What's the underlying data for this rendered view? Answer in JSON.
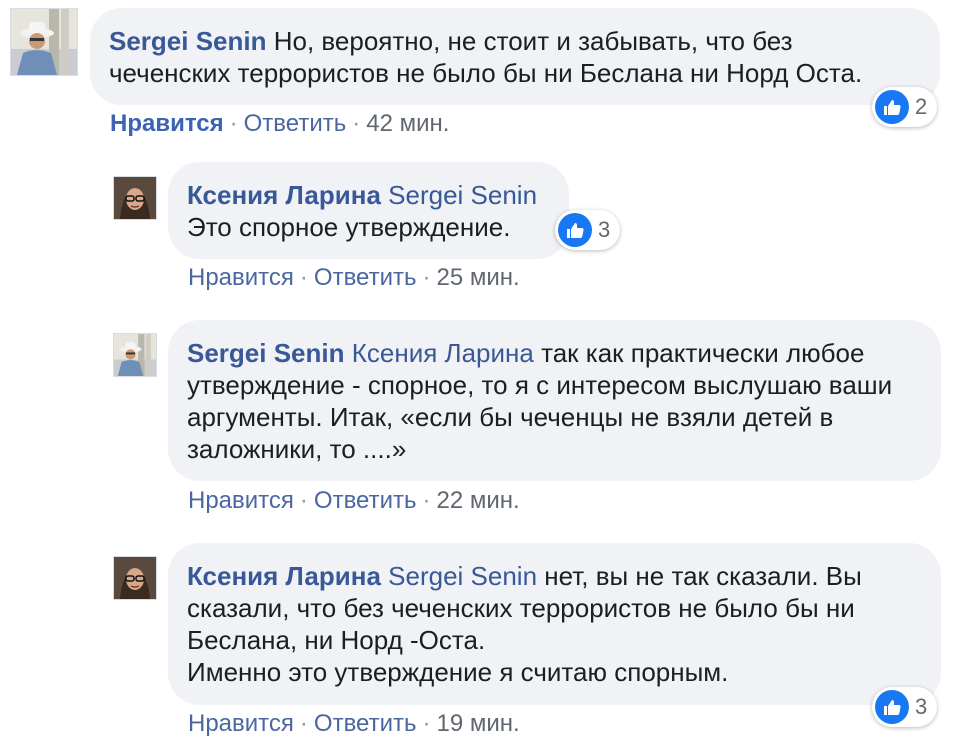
{
  "comments": [
    {
      "author": "Sergei Senin",
      "mention": "",
      "text": " Но, вероятно, не стоит и забывать, что без\nчеченских террористов не было бы ни Беслана ни Норд Оста.",
      "like_label": "Нравится",
      "reply_label": "Ответить",
      "time": "42 мин.",
      "reactions": "2",
      "avatar_icon": "profile-photo-man-in-hat"
    },
    {
      "author": "Ксения Ларина",
      "mention": "Sergei Senin",
      "text": "\nЭто спорное утверждение.",
      "like_label": "Нравится",
      "reply_label": "Ответить",
      "time": "25 мин.",
      "reactions": "3",
      "avatar_icon": "profile-photo-woman-glasses"
    },
    {
      "author": "Sergei Senin",
      "mention": "Ксения Ларина",
      "text": " так как практически любое\nутверждение - спорное, то я с интересом выслушаю ваши\nаргументы. Итак, «если бы чеченцы не взяли детей в\nзаложники, то ....»",
      "like_label": "Нравится",
      "reply_label": "Ответить",
      "time": "22 мин.",
      "reactions": "",
      "avatar_icon": "profile-photo-man-in-hat"
    },
    {
      "author": "Ксения Ларина",
      "mention": "Sergei Senin",
      "text": " нет, вы не так сказали. Вы\nсказали, что без чеченских террористов не было бы ни\nБеслана, ни Норд -Оста.\nИменно это утверждение я считаю спорным.",
      "like_label": "Нравится",
      "reply_label": "Ответить",
      "time": "19 мин.",
      "reactions": "3",
      "avatar_icon": "profile-photo-woman-glasses"
    }
  ],
  "dot": "·",
  "colors": {
    "link": "#385898",
    "bubble": "#f0f2f5",
    "like_blue": "#1877f2"
  }
}
